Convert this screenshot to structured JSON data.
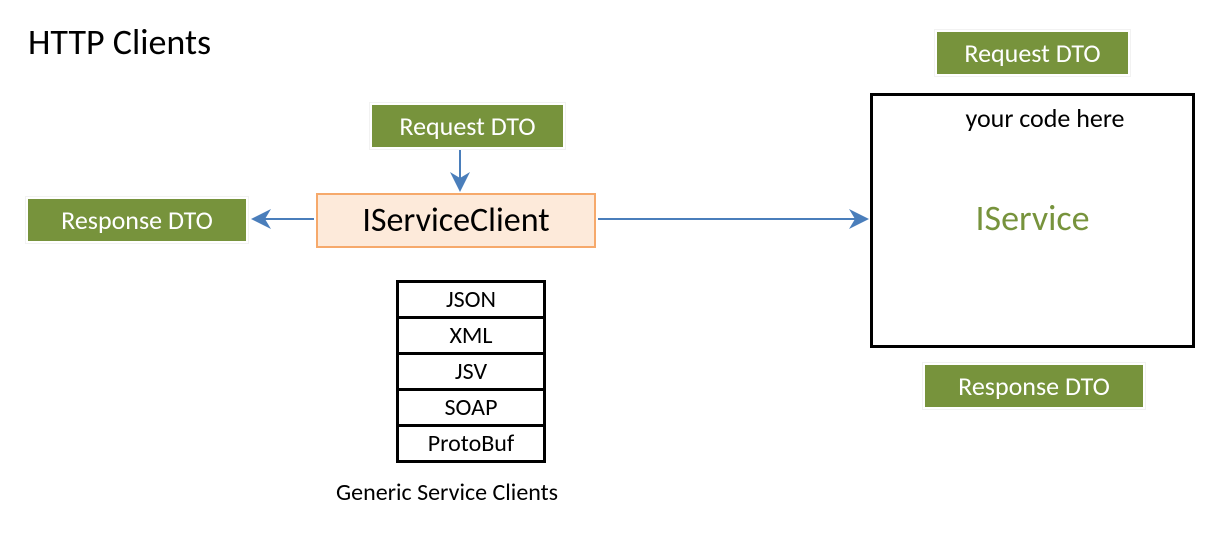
{
  "title": "HTTP Clients",
  "left": {
    "request_dto": "Request DTO",
    "response_dto": "Response DTO",
    "iservice_client": "IServiceClient"
  },
  "right": {
    "request_dto": "Request DTO",
    "response_dto": "Response DTO",
    "your_code_here": "your code here",
    "iservice": "IService"
  },
  "stack": {
    "items": [
      "JSON",
      "XML",
      "JSV",
      "SOAP",
      "ProtoBuf"
    ],
    "caption": "Generic Service Clients"
  },
  "colors": {
    "green": "#77933c",
    "orange_fill": "#fdeada",
    "orange_border": "#f6a96b",
    "arrow": "#4a7ebb"
  }
}
